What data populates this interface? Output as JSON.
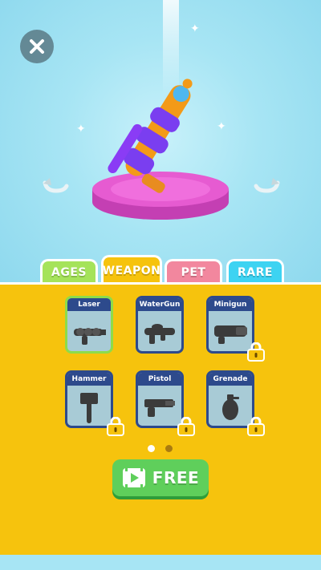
{
  "tabs": [
    {
      "label": "AGES"
    },
    {
      "label": "WEAPON"
    },
    {
      "label": "PET"
    },
    {
      "label": "RARE"
    }
  ],
  "weapons": [
    {
      "name": "Laser",
      "icon": "laser-gun-icon",
      "selected": true,
      "locked": false
    },
    {
      "name": "WaterGun",
      "icon": "water-gun-icon",
      "selected": false,
      "locked": false
    },
    {
      "name": "Minigun",
      "icon": "minigun-icon",
      "selected": false,
      "locked": true
    },
    {
      "name": "Hammer",
      "icon": "hammer-icon",
      "selected": false,
      "locked": true
    },
    {
      "name": "Pistol",
      "icon": "pistol-icon",
      "selected": false,
      "locked": true
    },
    {
      "name": "Grenade",
      "icon": "grenade-icon",
      "selected": false,
      "locked": true
    }
  ],
  "pagination": {
    "pages": 2,
    "current": 1
  },
  "free_button": {
    "label": "FREE",
    "icon": "video-play-icon"
  },
  "colors": {
    "panel_yellow": "#f6c30d",
    "card_border": "#2d4a8c",
    "selected_border": "#8ddc4a",
    "free_green": "#5fcf5b",
    "pedestal_pink": "#e65bd1"
  }
}
